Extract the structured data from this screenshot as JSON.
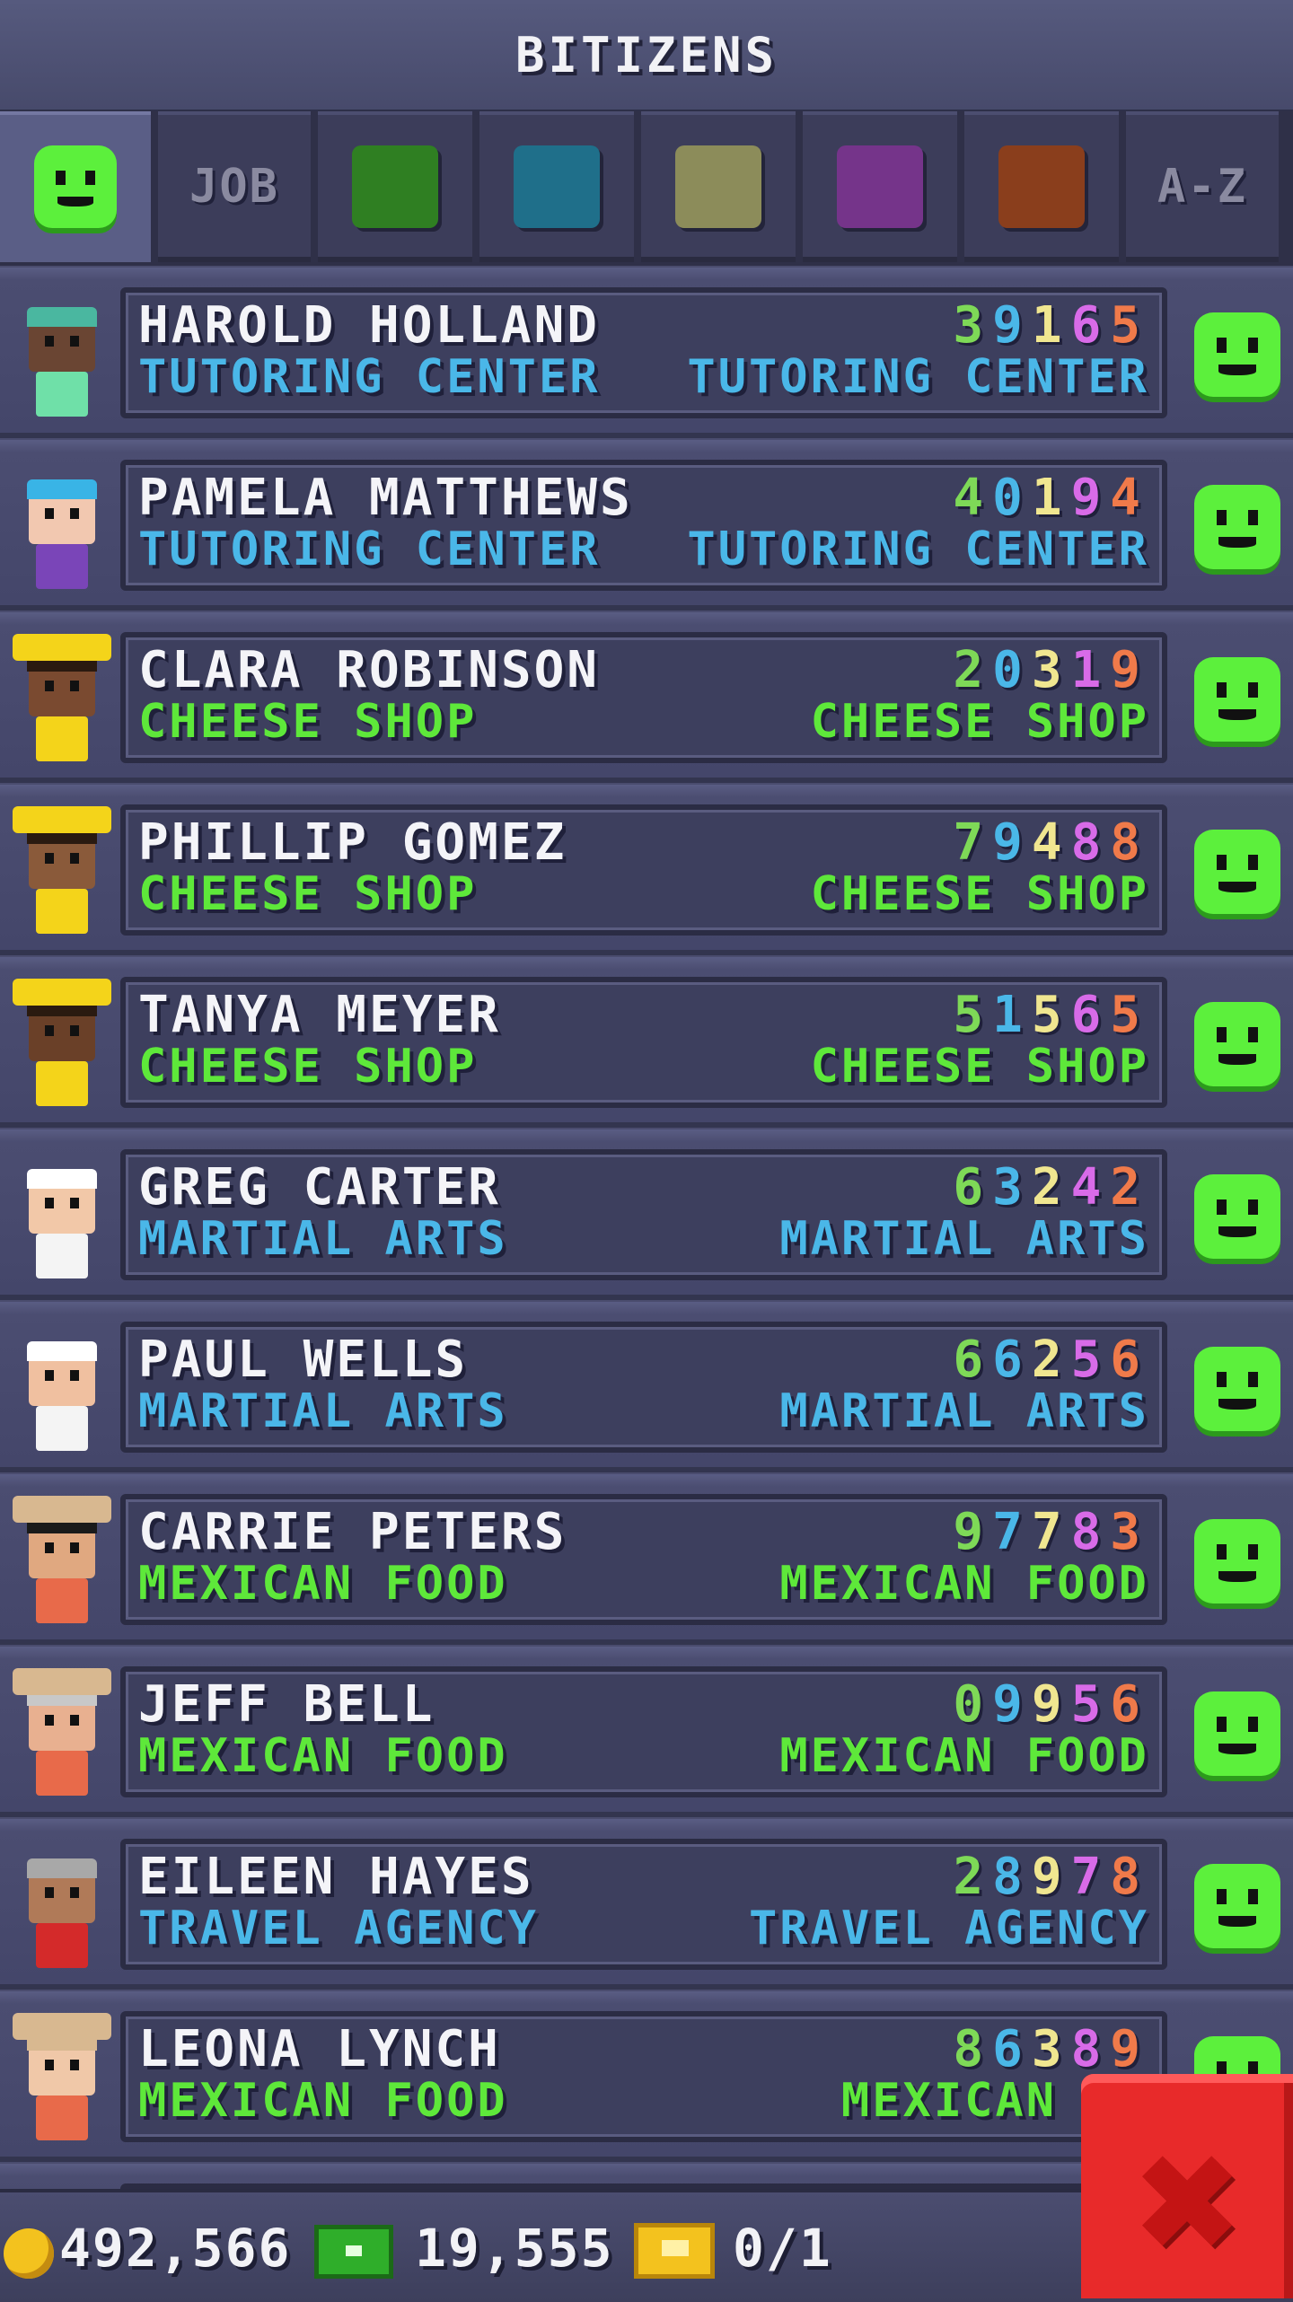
{
  "header": {
    "title": "BITIZENS"
  },
  "tabs": [
    {
      "kind": "smiley",
      "icon": "smiley-icon",
      "active": true
    },
    {
      "kind": "text",
      "label": "JOB"
    },
    {
      "kind": "color",
      "color": "#2f7f22",
      "name": "green"
    },
    {
      "kind": "color",
      "color": "#1f6f8a",
      "name": "blue"
    },
    {
      "kind": "color",
      "color": "#8c8c5a",
      "name": "olive"
    },
    {
      "kind": "color",
      "color": "#75348a",
      "name": "purple"
    },
    {
      "kind": "color",
      "color": "#8a3e1c",
      "name": "brown"
    },
    {
      "kind": "text",
      "label": "A-Z"
    }
  ],
  "digit_colors": [
    "#7ed957",
    "#4ab7e8",
    "#f0e690",
    "#d86be8",
    "#f07a4a"
  ],
  "bitizens": [
    {
      "name": "HAROLD HOLLAND",
      "digits": "39165",
      "home": "TUTORING CENTER",
      "job": "TUTORING CENTER",
      "biz_color": "#4ab7e8",
      "skin": "#6a4533",
      "hair": "#4ab7a0",
      "shirt": "#6fe0a8",
      "hat": null
    },
    {
      "name": "PAMELA MATTHEWS",
      "digits": "40194",
      "home": "TUTORING CENTER",
      "job": "TUTORING CENTER",
      "biz_color": "#4ab7e8",
      "skin": "#f2c8b0",
      "hair": "#39b4e6",
      "shirt": "#7a45b8",
      "hat": null
    },
    {
      "name": "CLARA ROBINSON",
      "digits": "20319",
      "home": "CHEESE SHOP",
      "job": "CHEESE SHOP",
      "biz_color": "#5ee83a",
      "skin": "#7a4a30",
      "hair": "#2a1a10",
      "shirt": "#f4d41a",
      "hat": "#f4d41a"
    },
    {
      "name": "PHILLIP GOMEZ",
      "digits": "79488",
      "home": "CHEESE SHOP",
      "job": "CHEESE SHOP",
      "biz_color": "#5ee83a",
      "skin": "#8a5a3a",
      "hair": "#2a1a10",
      "shirt": "#f4d41a",
      "hat": "#f4d41a"
    },
    {
      "name": "TANYA MEYER",
      "digits": "51565",
      "home": "CHEESE SHOP",
      "job": "CHEESE SHOP",
      "biz_color": "#5ee83a",
      "skin": "#6a4028",
      "hair": "#2a1a10",
      "shirt": "#f4d41a",
      "hat": "#f4d41a"
    },
    {
      "name": "GREG CARTER",
      "digits": "63242",
      "home": "MARTIAL ARTS",
      "job": "MARTIAL ARTS",
      "biz_color": "#4ab7e8",
      "skin": "#f2c8a8",
      "hair": "#ffffff",
      "shirt": "#f4f4f4",
      "hat": null
    },
    {
      "name": "PAUL WELLS",
      "digits": "66256",
      "home": "MARTIAL ARTS",
      "job": "MARTIAL ARTS",
      "biz_color": "#4ab7e8",
      "skin": "#f0c0a0",
      "hair": "#ffffff",
      "shirt": "#f4f4f4",
      "hat": null
    },
    {
      "name": "CARRIE PETERS",
      "digits": "97783",
      "home": "MEXICAN FOOD",
      "job": "MEXICAN FOOD",
      "biz_color": "#5ee83a",
      "skin": "#e0a880",
      "hair": "#1a1a1a",
      "shirt": "#e86a4a",
      "hat": "#d8b890"
    },
    {
      "name": "JEFF BELL",
      "digits": "09956",
      "home": "MEXICAN FOOD",
      "job": "MEXICAN FOOD",
      "biz_color": "#5ee83a",
      "skin": "#e8b090",
      "hair": "#c8c8c8",
      "shirt": "#e86a4a",
      "hat": "#d8b890"
    },
    {
      "name": "EILEEN HAYES",
      "digits": "28978",
      "home": "TRAVEL AGENCY",
      "job": "TRAVEL AGENCY",
      "biz_color": "#4ab7e8",
      "skin": "#b07a58",
      "hair": "#a8a8a8",
      "shirt": "#d42a2a",
      "hat": null
    },
    {
      "name": "LEONA LYNCH",
      "digits": "86389",
      "home": "MEXICAN FOOD",
      "job": "MEXICAN FO",
      "biz_color": "#5ee83a",
      "skin": "#f0c8a8",
      "hair": "#d8b890",
      "shirt": "#e86a4a",
      "hat": "#d8b890"
    }
  ],
  "footer": {
    "coins": "492,566",
    "bux": "19,555",
    "tickets": "0/1"
  },
  "close_icon": "close-icon"
}
